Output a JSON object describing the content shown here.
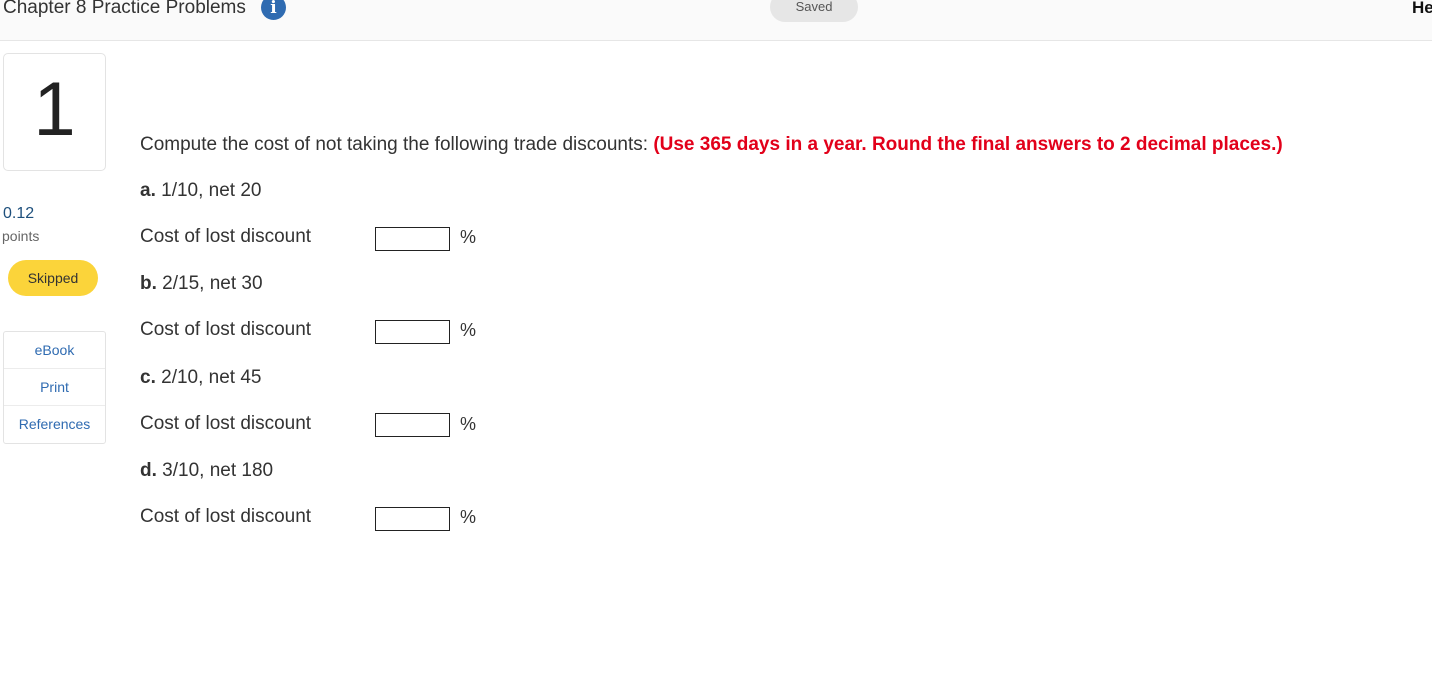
{
  "header": {
    "title": "Chapter 8 Practice Problems",
    "info_icon": "info-icon",
    "save_status": "Saved",
    "help_label": "He"
  },
  "question": {
    "number": "1",
    "points_value": "0.12",
    "points_label": "points",
    "status": "Skipped",
    "resources": [
      "eBook",
      "Print",
      "References"
    ],
    "prompt": "Compute the cost of not taking the following trade discounts:",
    "instruction": "(Use 365 days in a year. Round the final answers to 2 decimal places.)",
    "parts": [
      {
        "letter": "a.",
        "terms": "1/10, net 20",
        "label": "Cost of lost discount",
        "value": "",
        "unit": "%"
      },
      {
        "letter": "b.",
        "terms": "2/15, net 30",
        "label": "Cost of lost discount",
        "value": "",
        "unit": "%"
      },
      {
        "letter": "c.",
        "terms": "2/10, net 45",
        "label": "Cost of lost discount",
        "value": "",
        "unit": "%"
      },
      {
        "letter": "d.",
        "terms": "3/10, net 180",
        "label": "Cost of lost discount",
        "value": "",
        "unit": "%"
      }
    ]
  },
  "colors": {
    "instruction_red": "#e2001a",
    "status_yellow": "#fbd43a",
    "link_blue": "#2f6bb1",
    "points_blue": "#1d4f7c"
  }
}
